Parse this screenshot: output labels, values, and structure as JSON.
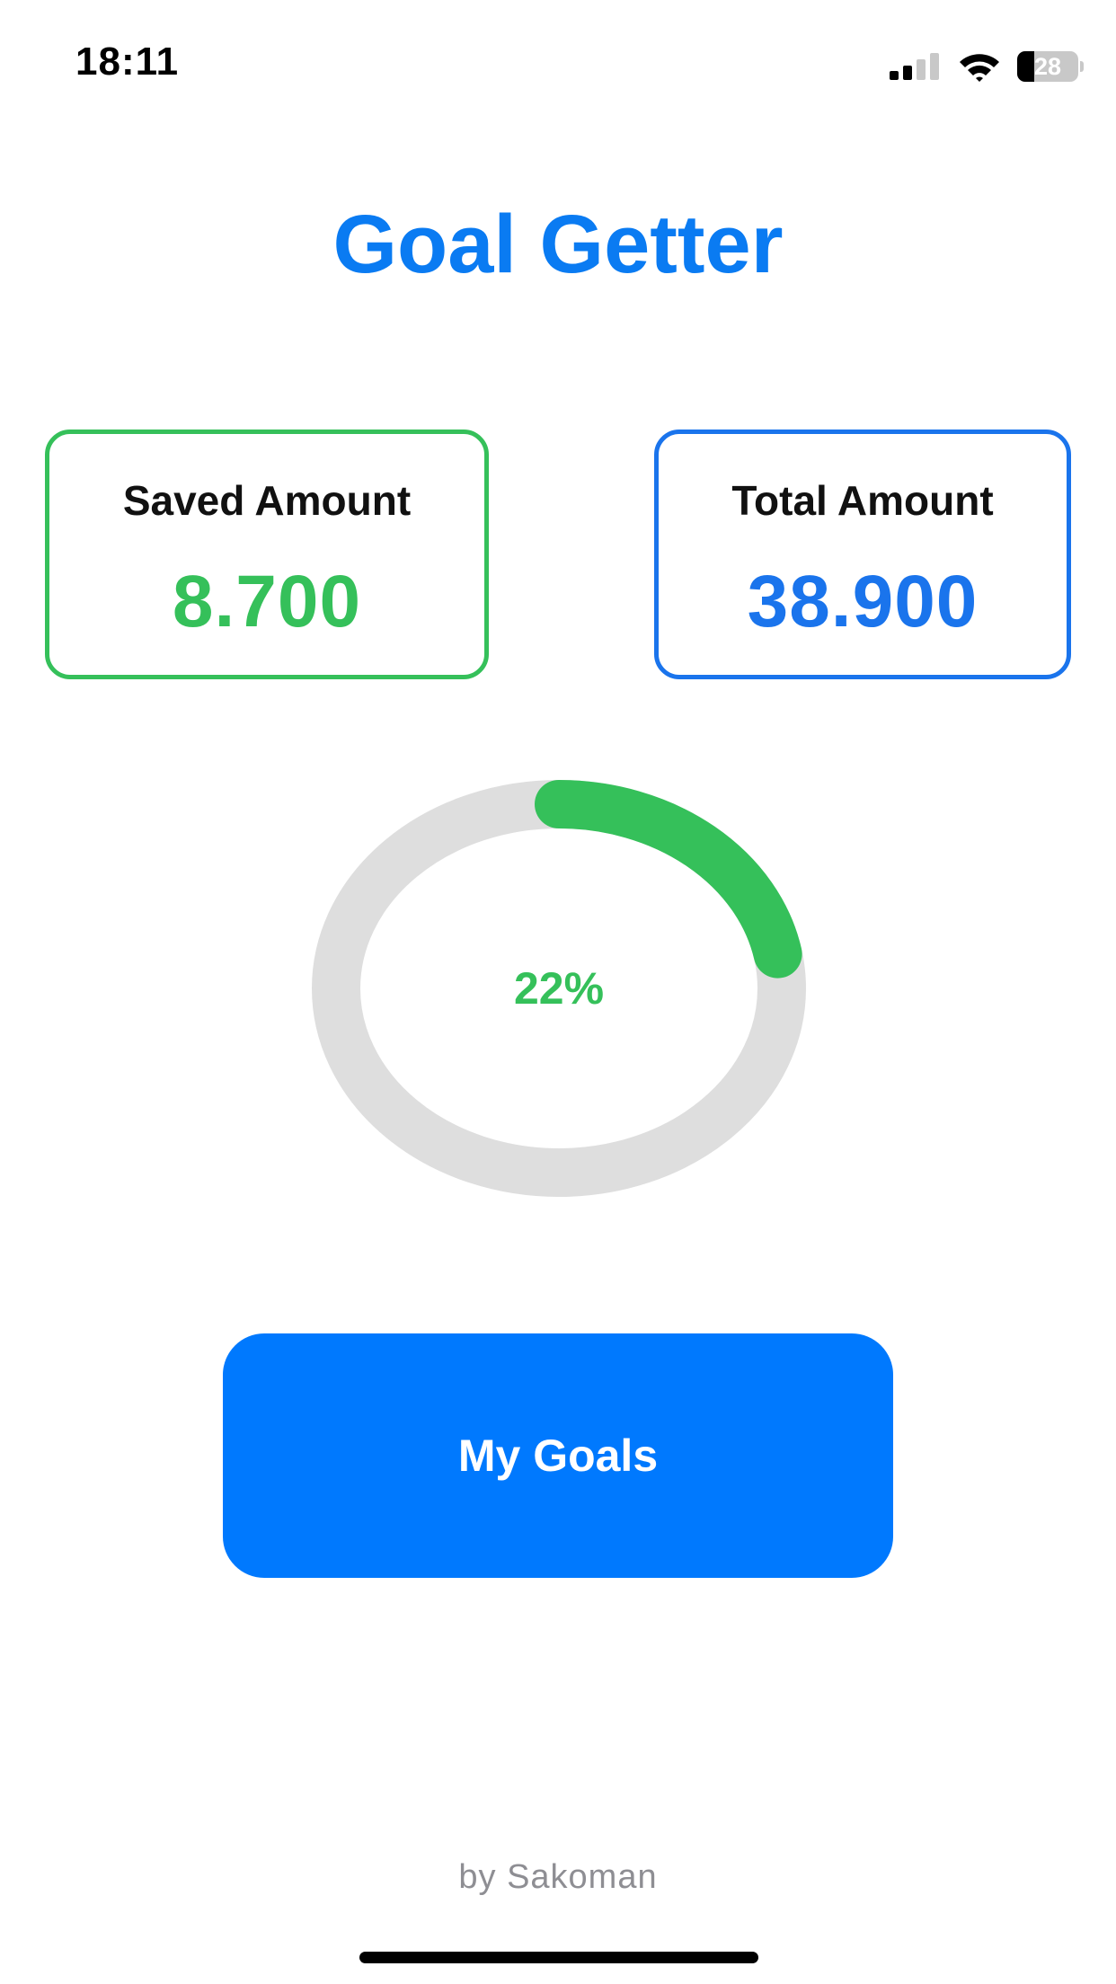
{
  "status_bar": {
    "time": "18:11",
    "battery_level": "28",
    "battery_fraction": 0.28,
    "signal_bars_active": 2,
    "signal_bars_total": 4,
    "icons": [
      "signal-icon",
      "wifi-icon",
      "battery-icon"
    ]
  },
  "header": {
    "title": "Goal Getter"
  },
  "cards": {
    "saved": {
      "label": "Saved Amount",
      "value": "8.700"
    },
    "total": {
      "label": "Total Amount",
      "value": "38.900"
    }
  },
  "progress": {
    "label": "22%",
    "fraction": 0.22
  },
  "actions": {
    "my_goals_label": "My Goals"
  },
  "footer": {
    "credit": "by Sakoman"
  },
  "colors": {
    "title": "#0a7bf2",
    "saved_accent": "#35c05a",
    "total_accent": "#1a74ec",
    "progress_track": "#dedede",
    "progress_fill": "#35c05a",
    "button_bg": "#0079fe",
    "footer_text": "#8e8e93"
  }
}
